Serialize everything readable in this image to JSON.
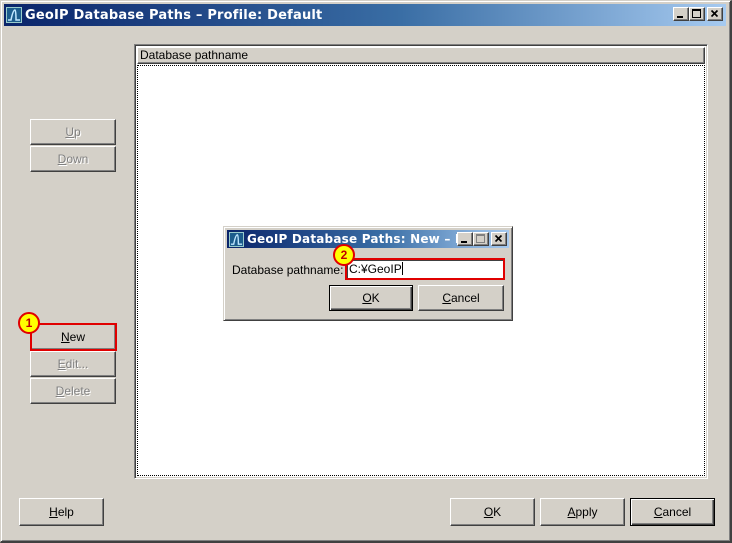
{
  "main_window": {
    "title": "GeoIP Database Paths – Profile: Default",
    "icon": "geoip-app-icon",
    "controls": {
      "minimize": "minimize-icon",
      "maximize": "maximize-icon",
      "close": "close-icon"
    }
  },
  "list": {
    "column_header": "Database pathname",
    "rows": []
  },
  "side_buttons": {
    "up": {
      "label": "Up",
      "mnemonic": "U",
      "enabled": false
    },
    "down": {
      "label": "Down",
      "mnemonic": "D",
      "enabled": false
    },
    "new": {
      "label": "New",
      "mnemonic": "N",
      "enabled": true
    },
    "edit": {
      "label": "Edit...",
      "mnemonic": "E",
      "enabled": false
    },
    "delete": {
      "label": "Delete",
      "mnemonic": "D",
      "enabled": false
    }
  },
  "bottom_buttons": {
    "help": {
      "label": "Help",
      "mnemonic": "H"
    },
    "ok": {
      "label": "OK",
      "mnemonic": "O"
    },
    "apply": {
      "label": "Apply",
      "mnemonic": "A"
    },
    "cancel": {
      "label": "Cancel",
      "mnemonic": "C"
    }
  },
  "new_dialog": {
    "title": "GeoIP Database Paths: New – Pr...",
    "field_label": "Database pathname:",
    "field_value": "C:¥GeoIP",
    "ok": {
      "label": "OK",
      "mnemonic": "O"
    },
    "cancel": {
      "label": "Cancel",
      "mnemonic": "C"
    }
  },
  "annotations": {
    "step1": "1",
    "step2": "2",
    "highlight_color": "#e00000",
    "marker_color": "#ffff00"
  }
}
